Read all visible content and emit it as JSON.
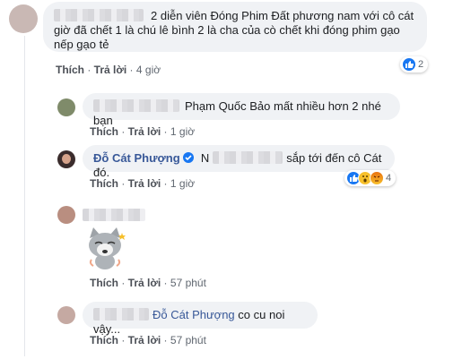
{
  "c1": {
    "text": "2 diễn viên Đóng Phim Đất phương nam với cô cát giờ đã chết 1 là chú lê bình 2 là cha của cò chết khi đóng phim gạo nếp gạo tẻ",
    "like": "Thích",
    "reply": "Trả lời",
    "time": "4 giờ",
    "reaction_count": "2"
  },
  "c2": {
    "text": "Phạm Quốc Bảo mất nhiều hơn 2 nhé bạn",
    "like": "Thích",
    "reply": "Trả lời",
    "time": "1 giờ"
  },
  "c3": {
    "author": "Đỗ Cát Phượng",
    "text_prefix": "N",
    "text": "sắp tới đến cô Cát đó.",
    "like": "Thích",
    "reply": "Trả lời",
    "time": "1 giờ",
    "reaction_count": "4"
  },
  "c4": {
    "like": "Thích",
    "reply": "Trả lời",
    "time": "57 phút",
    "sticker": "gray-cat-sticker"
  },
  "c5": {
    "tag": "Đỗ Cát Phượng",
    "text": "co cu noi vậy...",
    "like": "Thích",
    "reply": "Trả lời",
    "time": "57 phút"
  },
  "colors": {
    "link": "#385898",
    "bubble": "#f0f2f5",
    "like_blue": "#1877f2",
    "verified": "#1877f2"
  }
}
